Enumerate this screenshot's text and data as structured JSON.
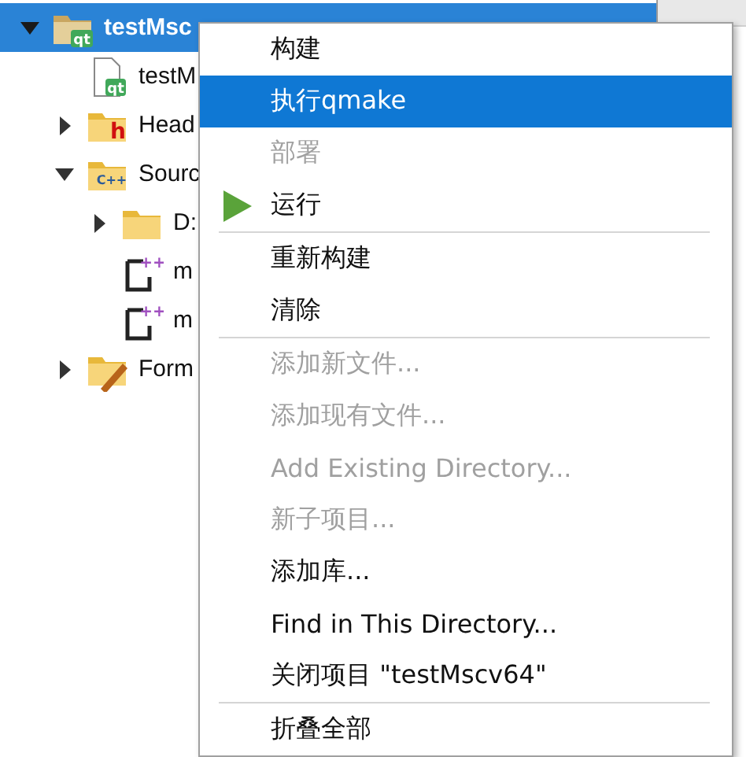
{
  "tree": [
    {
      "label": "testMsc",
      "kind": "project",
      "badge": "qt",
      "expanded": true,
      "selected": true,
      "children": [
        {
          "label": "testM",
          "kind": "pro-file",
          "badge": "qt",
          "selected": false
        },
        {
          "label": "Head",
          "kind": "header-folder",
          "badge": "h",
          "expanded": false,
          "selected": false
        },
        {
          "label": "Sourc",
          "kind": "source-folder",
          "badge": "C++",
          "expanded": true,
          "selected": false,
          "children": [
            {
              "label": "D:",
              "kind": "folder",
              "expanded": false,
              "selected": false
            },
            {
              "label": "m",
              "kind": "source-file",
              "badge": "++",
              "selected": false
            },
            {
              "label": "m",
              "kind": "source-file",
              "badge": "++",
              "selected": false
            }
          ]
        },
        {
          "label": "Form",
          "kind": "forms-folder",
          "expanded": false,
          "selected": false
        }
      ]
    }
  ],
  "context_menu": {
    "items": [
      {
        "kind": "item",
        "label": "构建",
        "disabled": false,
        "selected": false
      },
      {
        "kind": "item",
        "label": "执行qmake",
        "disabled": false,
        "selected": true
      },
      {
        "kind": "item",
        "label": "部署",
        "disabled": true,
        "selected": false
      },
      {
        "kind": "run",
        "label": "运行",
        "disabled": false,
        "selected": false
      },
      {
        "kind": "separator"
      },
      {
        "kind": "item",
        "label": "重新构建",
        "disabled": false,
        "selected": false
      },
      {
        "kind": "item",
        "label": "清除",
        "disabled": false,
        "selected": false
      },
      {
        "kind": "separator"
      },
      {
        "kind": "item",
        "label": "添加新文件...",
        "disabled": true,
        "selected": false
      },
      {
        "kind": "item",
        "label": "添加现有文件...",
        "disabled": true,
        "selected": false
      },
      {
        "kind": "item",
        "label": "Add Existing Directory...",
        "disabled": true,
        "selected": false
      },
      {
        "kind": "item",
        "label": "新子项目...",
        "disabled": true,
        "selected": false
      },
      {
        "kind": "item",
        "label": "添加库...",
        "disabled": false,
        "selected": false
      },
      {
        "kind": "item",
        "label": "Find in This Directory...",
        "disabled": false,
        "selected": false
      },
      {
        "kind": "item",
        "label": "关闭项目 \"testMscv64\"",
        "disabled": false,
        "selected": false
      },
      {
        "kind": "separator"
      },
      {
        "kind": "item",
        "label": "折叠全部",
        "disabled": false,
        "selected": false
      }
    ]
  }
}
